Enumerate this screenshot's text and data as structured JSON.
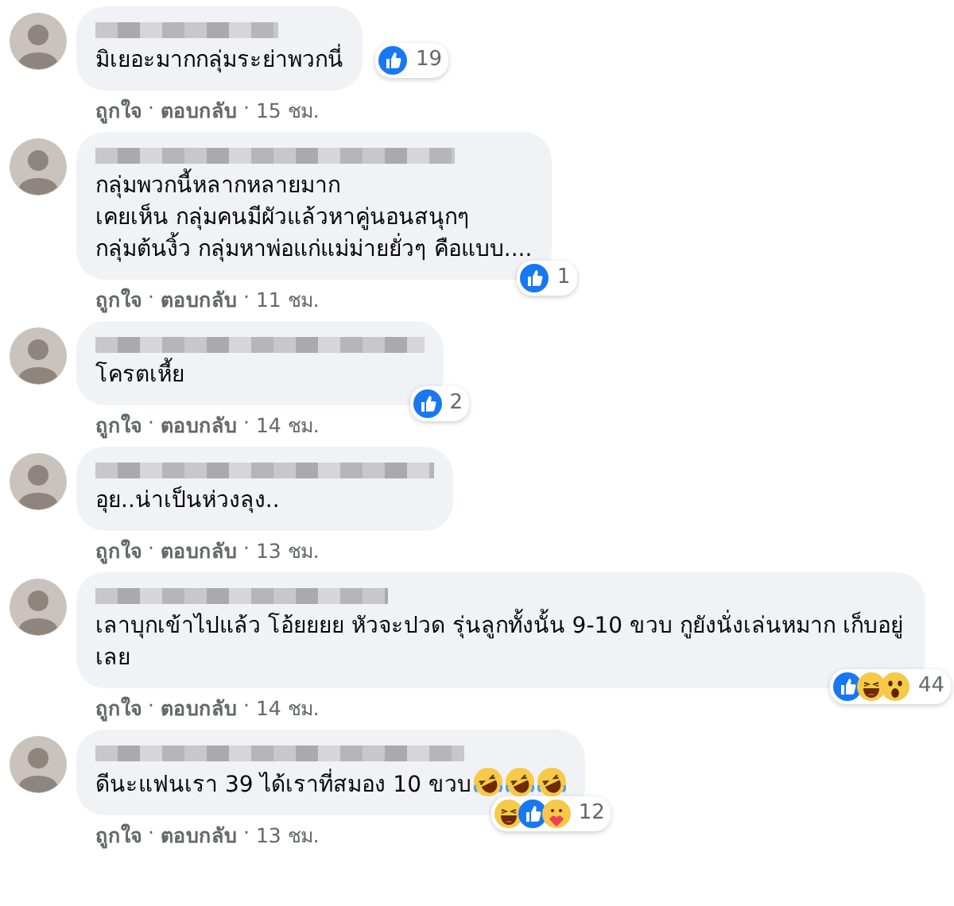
{
  "action_separator": "·",
  "comments": [
    {
      "lines": [
        "มิเยอะมากกลุ่มระย่าพวกนี่"
      ],
      "reactions": {
        "kind": "inline",
        "icons": [
          {
            "kind": "like"
          }
        ],
        "count": "19"
      },
      "like_label": "ถูกใจ",
      "reply_label": "ตอบกลับ",
      "time": "15 ชม."
    },
    {
      "lines": [
        "กลุ่มพวกนี้หลากหลายมาก",
        "เคยเห็น กลุ่มคนมีผัวแล้วหาคู่นอนสนุกๆ",
        "กลุ่มต้นงิ้ว กลุ่มหาพ่อแก่แม่ม่ายยั่วๆ คือแบบ...."
      ],
      "reactions": {
        "kind": "corner",
        "icons": [
          {
            "kind": "like"
          }
        ],
        "count": "1"
      },
      "like_label": "ถูกใจ",
      "reply_label": "ตอบกลับ",
      "time": "11 ชม."
    },
    {
      "lines": [
        "โครตเหี้ย"
      ],
      "reactions": {
        "kind": "corner",
        "icons": [
          {
            "kind": "like"
          }
        ],
        "count": "2"
      },
      "like_label": "ถูกใจ",
      "reply_label": "ตอบกลับ",
      "time": "14 ชม."
    },
    {
      "lines": [
        "อุย..น่าเป็นห่วงลุง.."
      ],
      "like_label": "ถูกใจ",
      "reply_label": "ตอบกลับ",
      "time": "13 ชม."
    },
    {
      "lines": [
        "เลาบุกเข้าไปแล้ว โอ้ยยยย หัวจะปวด รุ่นลูกทั้งนั้น 9-10 ขวบ กูยังนั่งเล่นหมาก เก็บอยู่เลย"
      ],
      "reactions": {
        "kind": "corner",
        "icons": [
          {
            "kind": "like"
          },
          {
            "kind": "haha"
          },
          {
            "kind": "wow"
          }
        ],
        "count": "44"
      },
      "like_label": "ถูกใจ",
      "reply_label": "ตอบกลับ",
      "time": "14 ชม."
    },
    {
      "lines": [
        "ดีนะแฟนเรา 39 ได้เราที่สมอง 10 ขวบ"
      ],
      "emojis": [
        {
          "kind": "rofl"
        },
        {
          "kind": "rofl"
        },
        {
          "kind": "rofl"
        }
      ],
      "reactions": {
        "kind": "corner",
        "icons": [
          {
            "kind": "haha"
          },
          {
            "kind": "like"
          },
          {
            "kind": "care"
          }
        ],
        "count": "12"
      },
      "like_label": "ถูกใจ",
      "reply_label": "ตอบกลับ",
      "time": "13 ชม."
    }
  ]
}
